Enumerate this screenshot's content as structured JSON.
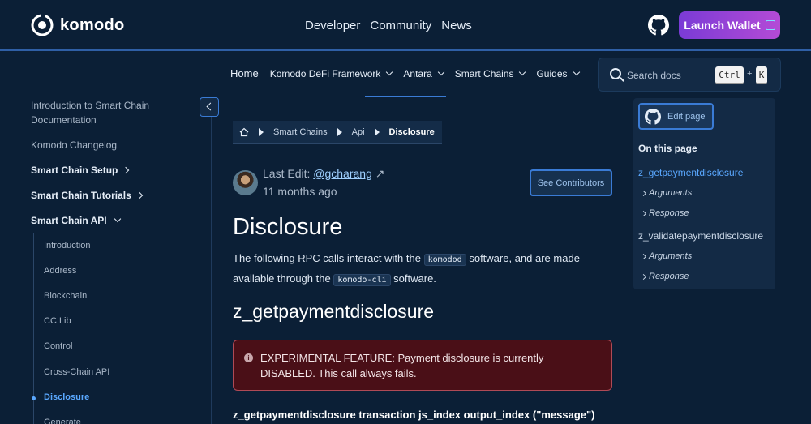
{
  "brand": {
    "name": "komodo"
  },
  "topnav": [
    "Developer",
    "Community",
    "News"
  ],
  "launch_button": "Launch Wallet",
  "subnav": {
    "home": "Home",
    "items": [
      "Komodo DeFi Framework",
      "Antara",
      "Smart Chains",
      "Guides"
    ]
  },
  "search": {
    "placeholder": "Search docs",
    "key1": "Ctrl",
    "plus": "+",
    "key2": "K"
  },
  "sidebar": {
    "top_items": [
      "Introduction to Smart Chain Documentation",
      "Komodo Changelog"
    ],
    "sections": [
      "Smart Chain Setup",
      "Smart Chain Tutorials",
      "Smart Chain API"
    ],
    "api_items": [
      "Introduction",
      "Address",
      "Blockchain",
      "CC Lib",
      "Control",
      "Cross-Chain API",
      "Disclosure",
      "Generate"
    ]
  },
  "breadcrumb": [
    "Smart Chains",
    "Api",
    "Disclosure"
  ],
  "meta": {
    "last_edit_label": "Last Edit:",
    "editor": "@gcharang",
    "ago": "11 months ago",
    "contributors_button": "See Contributors"
  },
  "article": {
    "title": "Disclosure",
    "intro_1": "The following RPC calls interact with the",
    "code_1": "komodod",
    "intro_2": "software, and are made available through the",
    "code_2": "komodo-cli",
    "intro_3": "software.",
    "h2": "z_getpaymentdisclosure",
    "alert": "EXPERIMENTAL FEATURE: Payment disclosure is currently DISABLED. This call always fails.",
    "signature": "z_getpaymentdisclosure transaction js_index output_index (\"message\")"
  },
  "toc": {
    "edit_page": "Edit page",
    "heading": "On this page",
    "links": [
      "z_getpaymentdisclosure",
      "z_validatepaymentdisclosure"
    ],
    "sub": [
      "Arguments",
      "Response"
    ]
  },
  "colors": {
    "accent": "#3a7bd5",
    "active_link": "#5aa8ff",
    "alert_bg": "#4a0f17",
    "background": "#0b1f36"
  }
}
